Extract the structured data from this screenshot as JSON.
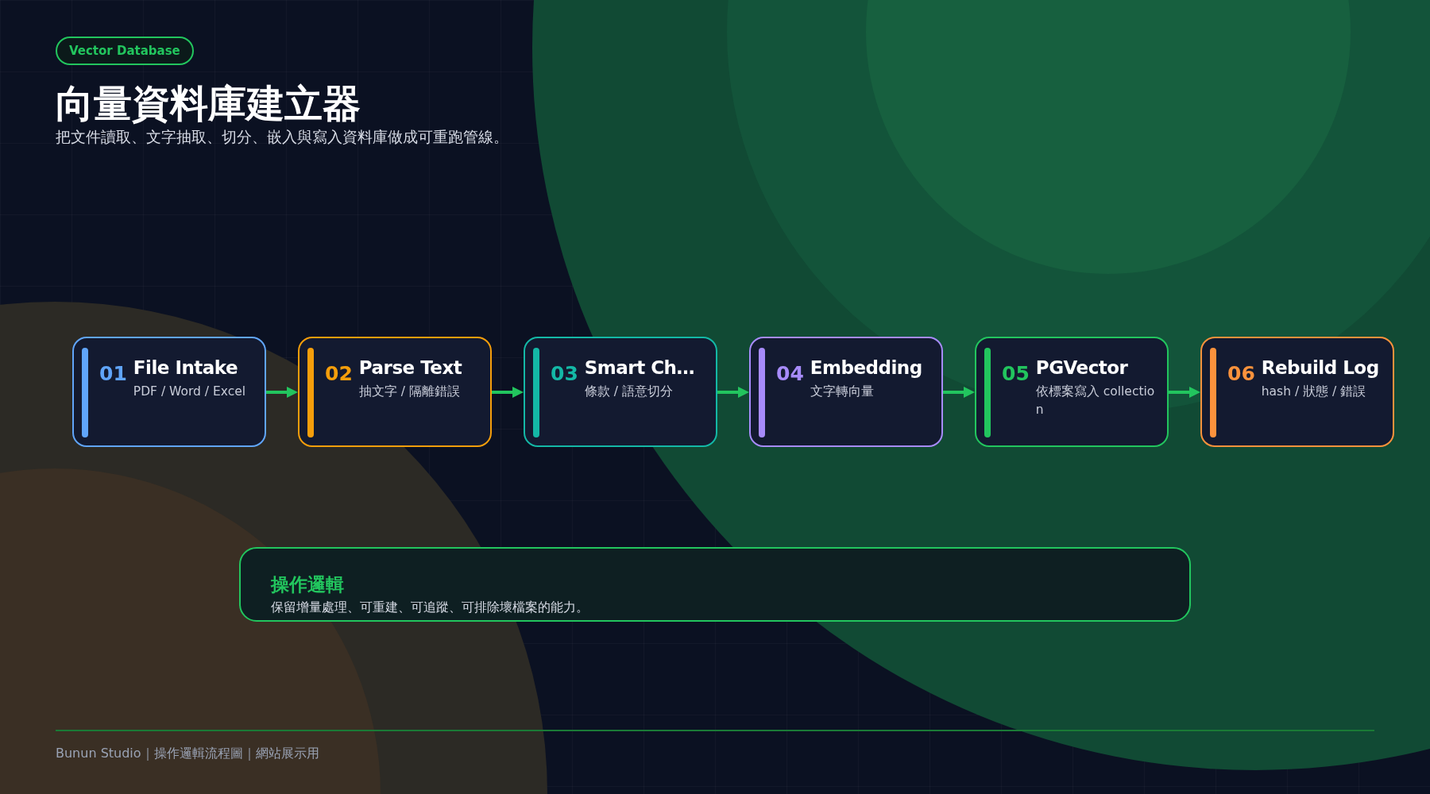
{
  "badge": "Vector Database",
  "title": "向量資料庫建立器",
  "subtitle": "把文件讀取、文字抽取、切分、嵌入與寫入資料庫做成可重跑管線。",
  "steps": [
    {
      "number": "01",
      "title": "File Intake",
      "detail": "PDF / Word / Excel",
      "color": "#60a5fa"
    },
    {
      "number": "02",
      "title": "Parse Text",
      "detail": "抽文字 / 隔離錯誤",
      "color": "#f59e0b"
    },
    {
      "number": "03",
      "title": "Smart Ch…",
      "detail": "條款 / 語意切分",
      "color": "#14b8a6"
    },
    {
      "number": "04",
      "title": "Embedding",
      "detail": "文字轉向量",
      "color": "#a78bfa"
    },
    {
      "number": "05",
      "title": "PGVector",
      "detail": "依標案寫入 collection",
      "color": "#22c55e"
    },
    {
      "number": "06",
      "title": "Rebuild Log",
      "detail": "hash / 狀態 / 錯誤",
      "color": "#fb923c"
    }
  ],
  "note": {
    "heading": "操作邏輯",
    "text": "保留增量處理、可重建、可追蹤、可排除壞檔案的能力。"
  },
  "footer": "Bunun Studio｜操作邏輯流程圖｜網站展示用"
}
